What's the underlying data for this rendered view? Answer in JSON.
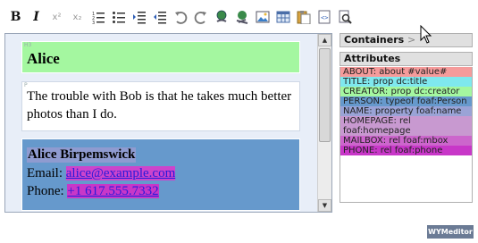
{
  "toolbar": {
    "buttons": [
      {
        "name": "bold-button",
        "label": "B"
      },
      {
        "name": "italic-button",
        "label": "I"
      },
      {
        "name": "superscript-button",
        "label": "x²"
      },
      {
        "name": "subscript-button",
        "label": "x₂"
      }
    ],
    "icons": [
      "ordered-list-icon",
      "unordered-list-icon",
      "indent-icon",
      "outdent-icon",
      "undo-icon",
      "redo-icon",
      "link-icon",
      "unlink-icon",
      "image-icon",
      "table-icon",
      "paste-icon",
      "html-icon",
      "preview-icon"
    ]
  },
  "editor": {
    "blocks": {
      "h3": {
        "tag": "H3",
        "text": "Alice"
      },
      "p": {
        "tag": "P",
        "text": "The trouble with Bob is that he takes much better photos than I do."
      },
      "vcard": {
        "name": "Alice Birpemswick",
        "email_label": "Email: ",
        "email": "alice@example.com",
        "phone_label": "Phone: ",
        "phone": "+1 617.555.7332"
      }
    }
  },
  "panel": {
    "containers_label": "Containers",
    "containers_arrow": ">",
    "attributes_label": "Attributes",
    "attributes": [
      {
        "text": "ABOUT: about #value#",
        "color": "#f59b9b"
      },
      {
        "text": "TITLE: prop dc:title",
        "color": "#7fe8ee"
      },
      {
        "text": "CREATOR: prop dc:creator",
        "color": "#a4f7a0"
      },
      {
        "text": "PERSON: typeof foaf:Person",
        "color": "#6699cc"
      },
      {
        "text": "NAME: property foaf:name",
        "color": "#9aa3d6"
      },
      {
        "text": "HOMEPAGE: rel foaf:homepage",
        "color": "#c899d0"
      },
      {
        "text": "MAILBOX: rel foaf:mbox",
        "color": "#cc66cc"
      },
      {
        "text": "PHONE: rel foaf:phone",
        "color": "#c837c8"
      }
    ]
  },
  "footer": {
    "brand": "WYMeditor"
  }
}
